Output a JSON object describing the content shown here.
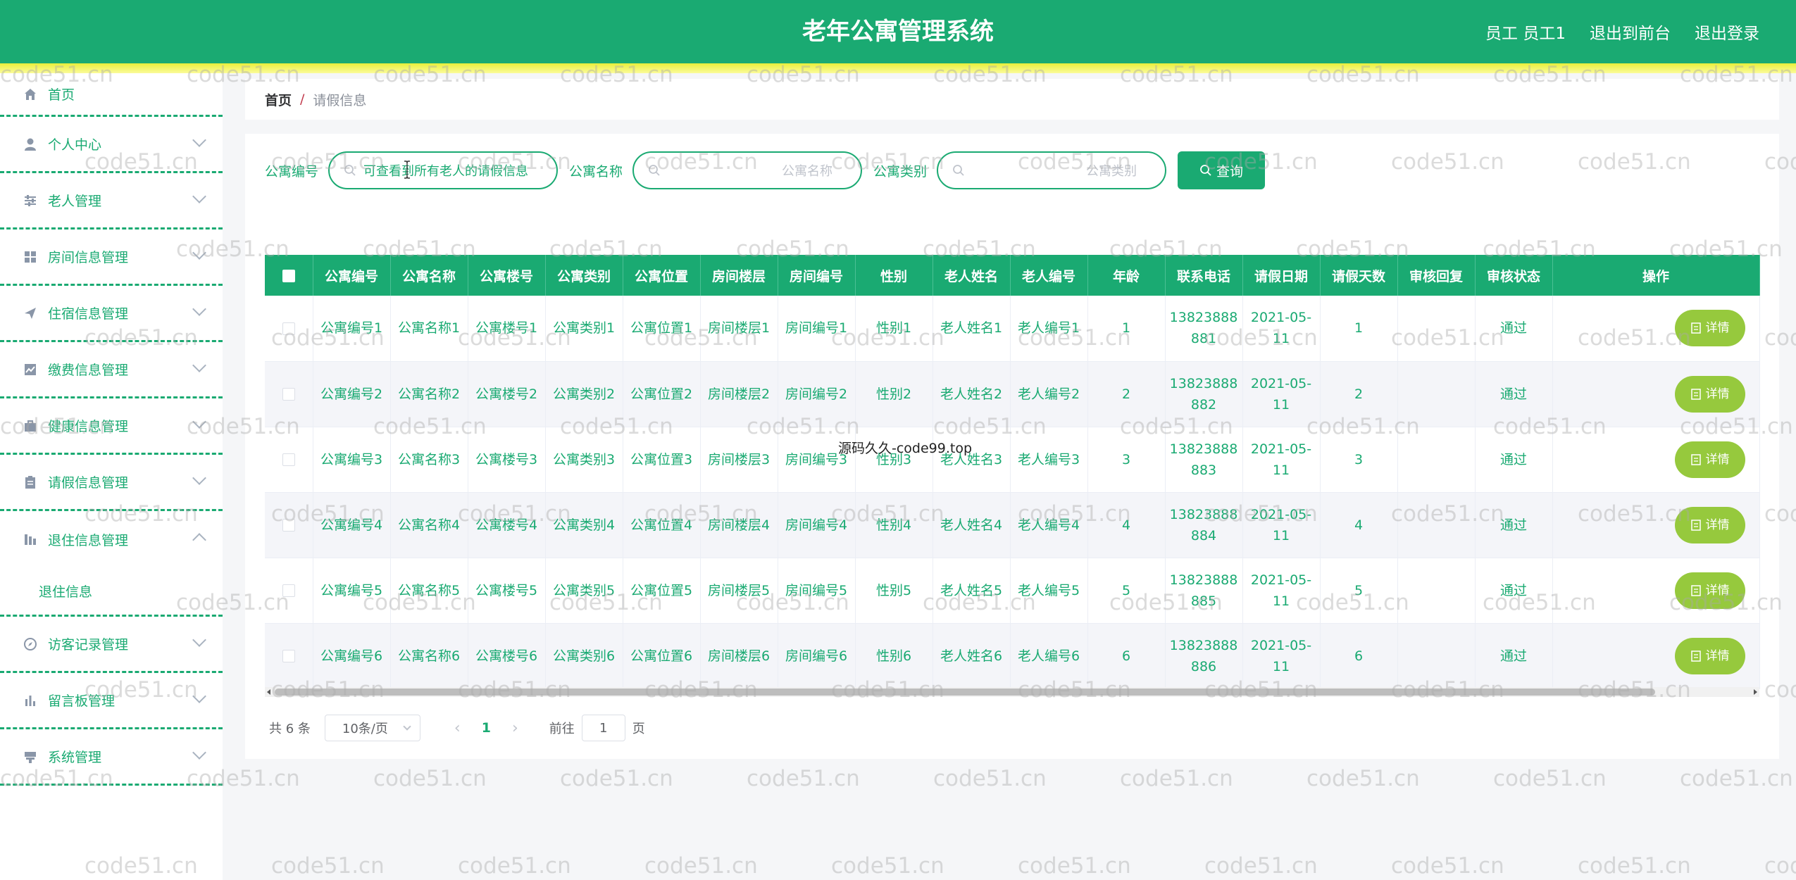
{
  "header": {
    "title": "老年公寓管理系统",
    "user_label": "员工 员工1",
    "back_frontend": "退出到前台",
    "logout": "退出登录"
  },
  "sidebar": {
    "items": [
      {
        "label": "首页",
        "icon": "home-icon"
      },
      {
        "label": "个人中心",
        "icon": "user-icon"
      },
      {
        "label": "老人管理",
        "icon": "sliders-icon"
      },
      {
        "label": "房间信息管理",
        "icon": "grid-icon"
      },
      {
        "label": "住宿信息管理",
        "icon": "send-icon"
      },
      {
        "label": "缴费信息管理",
        "icon": "chart-icon"
      },
      {
        "label": "健康信息管理",
        "icon": "briefcase-icon"
      },
      {
        "label": "请假信息管理",
        "icon": "clipboard-icon"
      },
      {
        "label": "退住信息管理",
        "icon": "bar-icon"
      },
      {
        "label": "访客记录管理",
        "icon": "compass-icon"
      },
      {
        "label": "留言板管理",
        "icon": "bar-chart-icon"
      },
      {
        "label": "系统管理",
        "icon": "setting-icon"
      }
    ],
    "submenu_label": "退住信息"
  },
  "breadcrumb": {
    "home": "首页",
    "separator": "/",
    "current": "请假信息"
  },
  "search": {
    "field1_label": "公寓编号",
    "field1_value": "可查看到所有老人的请假信息",
    "field2_label": "公寓名称",
    "field2_placeholder": "公寓名称",
    "field3_label": "公寓类别",
    "field3_placeholder": "公寓类别",
    "query_label": "查询"
  },
  "table": {
    "columns": [
      "公寓编号",
      "公寓名称",
      "公寓楼号",
      "公寓类别",
      "公寓位置",
      "房间楼层",
      "房间编号",
      "性别",
      "老人姓名",
      "老人编号",
      "年龄",
      "联系电话",
      "请假日期",
      "请假天数",
      "审核回复",
      "审核状态",
      "操作"
    ],
    "detail_label": "详情",
    "rows": [
      {
        "c1": "公寓编号1",
        "c2": "公寓名称1",
        "c3": "公寓楼号1",
        "c4": "公寓类别1",
        "c5": "公寓位置1",
        "c6": "房间楼层1",
        "c7": "房间编号1",
        "c8": "性别1",
        "c9": "老人姓名1",
        "c10": "老人编号1",
        "c11": "1",
        "c12": "13823888881",
        "c13": "2021-05-11",
        "c14": "1",
        "c15": "",
        "c16": "通过"
      },
      {
        "c1": "公寓编号2",
        "c2": "公寓名称2",
        "c3": "公寓楼号2",
        "c4": "公寓类别2",
        "c5": "公寓位置2",
        "c6": "房间楼层2",
        "c7": "房间编号2",
        "c8": "性别2",
        "c9": "老人姓名2",
        "c10": "老人编号2",
        "c11": "2",
        "c12": "13823888882",
        "c13": "2021-05-11",
        "c14": "2",
        "c15": "",
        "c16": "通过"
      },
      {
        "c1": "公寓编号3",
        "c2": "公寓名称3",
        "c3": "公寓楼号3",
        "c4": "公寓类别3",
        "c5": "公寓位置3",
        "c6": "房间楼层3",
        "c7": "房间编号3",
        "c8": "性别3",
        "c9": "老人姓名3",
        "c10": "老人编号3",
        "c11": "3",
        "c12": "13823888883",
        "c13": "2021-05-11",
        "c14": "3",
        "c15": "",
        "c16": "通过"
      },
      {
        "c1": "公寓编号4",
        "c2": "公寓名称4",
        "c3": "公寓楼号4",
        "c4": "公寓类别4",
        "c5": "公寓位置4",
        "c6": "房间楼层4",
        "c7": "房间编号4",
        "c8": "性别4",
        "c9": "老人姓名4",
        "c10": "老人编号4",
        "c11": "4",
        "c12": "13823888884",
        "c13": "2021-05-11",
        "c14": "4",
        "c15": "",
        "c16": "通过"
      },
      {
        "c1": "公寓编号5",
        "c2": "公寓名称5",
        "c3": "公寓楼号5",
        "c4": "公寓类别5",
        "c5": "公寓位置5",
        "c6": "房间楼层5",
        "c7": "房间编号5",
        "c8": "性别5",
        "c9": "老人姓名5",
        "c10": "老人编号5",
        "c11": "5",
        "c12": "13823888885",
        "c13": "2021-05-11",
        "c14": "5",
        "c15": "",
        "c16": "通过"
      },
      {
        "c1": "公寓编号6",
        "c2": "公寓名称6",
        "c3": "公寓楼号6",
        "c4": "公寓类别6",
        "c5": "公寓位置6",
        "c6": "房间楼层6",
        "c7": "房间编号6",
        "c8": "性别6",
        "c9": "老人姓名6",
        "c10": "老人编号6",
        "c11": "6",
        "c12": "13823888886",
        "c13": "2021-05-11",
        "c14": "6",
        "c15": "",
        "c16": "通过"
      }
    ]
  },
  "pager": {
    "total": "共 6 条",
    "page_size": "10条/页",
    "current_page": "1",
    "goto_label": "前往",
    "goto_value": "1",
    "page_unit": "页"
  },
  "watermark": {
    "text": "code51.cn",
    "center_text": "源码久久-code99.top"
  },
  "colors": {
    "primary": "#1aaa72",
    "accent_stripe": "#e9ef3a",
    "detail_button": "#96c93d"
  }
}
